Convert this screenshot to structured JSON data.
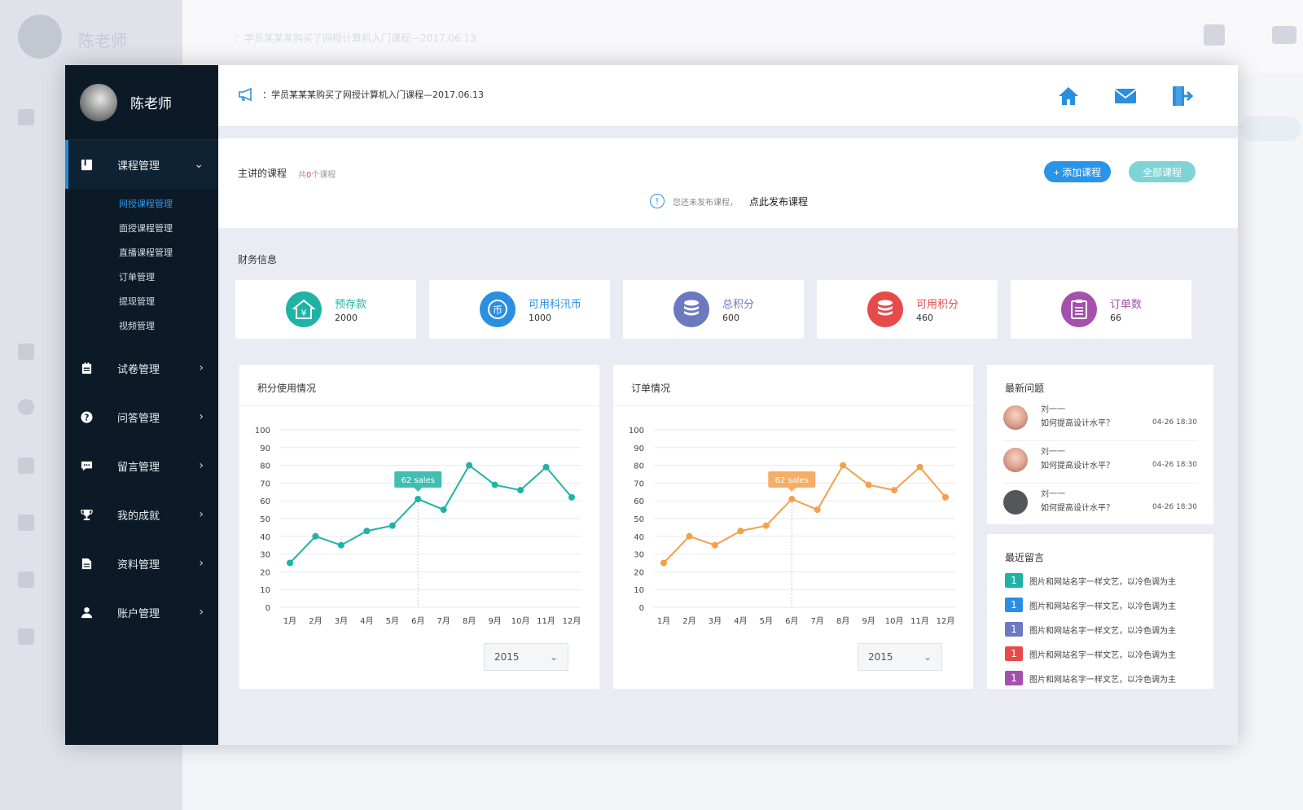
{
  "user": {
    "name": "陈老师"
  },
  "notice": "：学员某某某购买了网授计算机入门课程—2017.06.13",
  "topbar": {
    "icons": [
      "home-icon",
      "mail-icon",
      "logout-icon"
    ]
  },
  "sidebar": {
    "categories": [
      {
        "label": "课程管理",
        "icon": "course-icon",
        "expanded": true,
        "children": [
          "网授课程管理",
          "面授课程管理",
          "直播课程管理",
          "订单管理",
          "提现管理",
          "视频管理"
        ],
        "active_child": 0
      },
      {
        "label": "试卷管理",
        "icon": "exam-icon"
      },
      {
        "label": "问答管理",
        "icon": "qa-icon"
      },
      {
        "label": "留言管理",
        "icon": "message-icon"
      },
      {
        "label": "我的成就",
        "icon": "trophy-icon"
      },
      {
        "label": "资料管理",
        "icon": "document-icon"
      },
      {
        "label": "账户管理",
        "icon": "user-icon"
      }
    ]
  },
  "courses": {
    "title": "主讲的课程",
    "count_prefix": "共",
    "count": "0",
    "count_suffix": "个课程",
    "add_button": "+ 添加课程",
    "all_button": "全部课程",
    "empty_tip": "您还未发布课程，",
    "publish_link": "点此发布课程"
  },
  "finance": {
    "title": "财务信息",
    "cards": [
      {
        "label": "预存款",
        "value": "2000",
        "color": "#1fb3a6",
        "icon": "deposit-icon"
      },
      {
        "label": "可用科汛币",
        "value": "1000",
        "color": "#2a8fe0",
        "icon": "coin-icon"
      },
      {
        "label": "总积分",
        "value": "600",
        "color": "#6c79c0",
        "icon": "points-icon"
      },
      {
        "label": "可用积分",
        "value": "460",
        "color": "#e84a4a",
        "icon": "available-points-icon"
      },
      {
        "label": "订单数",
        "value": "66",
        "color": "#a451ab",
        "icon": "orders-icon"
      }
    ]
  },
  "charts": [
    {
      "title": "积分使用情况",
      "year": "2015"
    },
    {
      "title": "订单情况",
      "year": "2015"
    }
  ],
  "chart_data": [
    {
      "type": "line",
      "color": "#1fb3a6",
      "categories": [
        "1月",
        "2月",
        "3月",
        "4月",
        "5月",
        "6月",
        "7月",
        "8月",
        "9月",
        "10月",
        "11月",
        "12月"
      ],
      "values": [
        25,
        40,
        35,
        43,
        46,
        61,
        55,
        80,
        69,
        66,
        79,
        62
      ],
      "ylim": [
        0,
        100
      ],
      "yticks": [
        0,
        10,
        20,
        30,
        40,
        50,
        60,
        70,
        80,
        90,
        100
      ],
      "tooltip": {
        "index": 5,
        "text": "62 sales"
      }
    },
    {
      "type": "line",
      "color": "#f4a04a",
      "categories": [
        "1月",
        "2月",
        "3月",
        "4月",
        "5月",
        "6月",
        "7月",
        "8月",
        "9月",
        "10月",
        "11月",
        "12月"
      ],
      "values": [
        25,
        40,
        35,
        43,
        46,
        61,
        55,
        80,
        69,
        66,
        79,
        62
      ],
      "ylim": [
        0,
        100
      ],
      "yticks": [
        0,
        10,
        20,
        30,
        40,
        50,
        60,
        70,
        80,
        90,
        100
      ],
      "tooltip": {
        "index": 5,
        "text": "62 sales"
      }
    }
  ],
  "questions": {
    "title": "最新问题",
    "items": [
      {
        "name": "刘一一",
        "text": "如何提高设计水平？",
        "time": "04-26 18:30"
      },
      {
        "name": "刘一一",
        "text": "如何提高设计水平？",
        "time": "04-26 18:30"
      },
      {
        "name": "刘一一",
        "text": "如何提高设计水平？",
        "time": "04-26 18:30"
      }
    ]
  },
  "messages": {
    "title": "最近留言",
    "items": [
      {
        "num": "1",
        "color": "#1fb3a6",
        "text": "图片和网站名字一样文艺，以冷色调为主"
      },
      {
        "num": "1",
        "color": "#2a8fe0",
        "text": "图片和网站名字一样文艺，以冷色调为主"
      },
      {
        "num": "1",
        "color": "#6c79c0",
        "text": "图片和网站名字一样文艺，以冷色调为主"
      },
      {
        "num": "1",
        "color": "#e84a4a",
        "text": "图片和网站名字一样文艺，以冷色调为主"
      },
      {
        "num": "1",
        "color": "#a451ab",
        "text": "图片和网站名字一样文艺，以冷色调为主"
      }
    ]
  }
}
